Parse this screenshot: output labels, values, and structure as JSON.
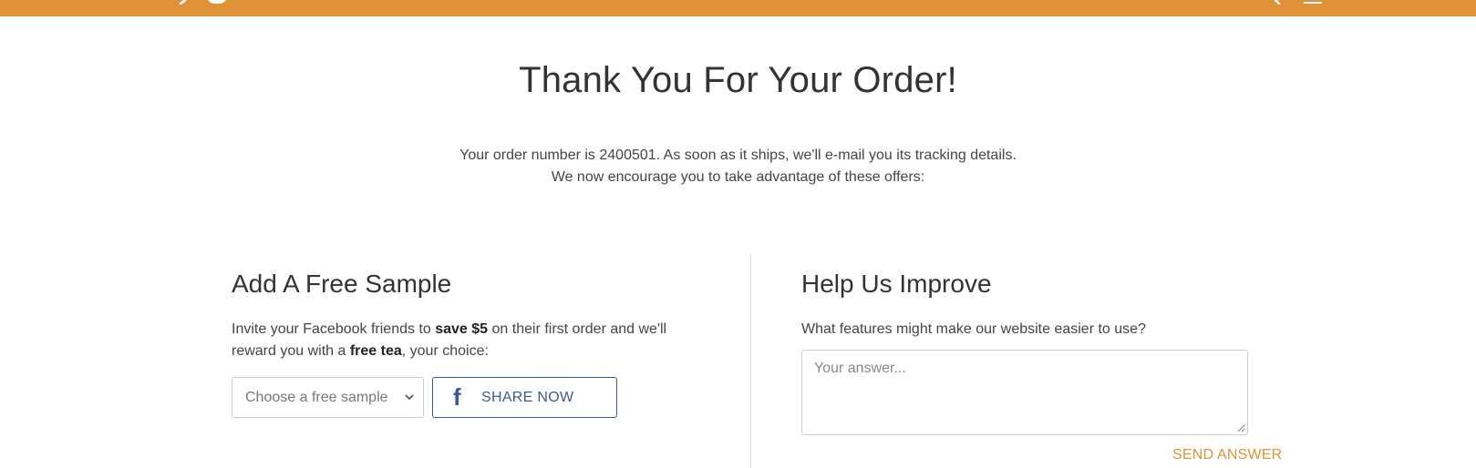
{
  "header": {
    "brand_color": "#df9236",
    "icons": [
      "leaf-logo-icon",
      "search-icon",
      "cart-icon"
    ]
  },
  "main": {
    "title": "Thank You For Your Order!",
    "intro_line1": "Your order number is 2400501. As soon as it ships, we'll e-mail you its tracking details.",
    "intro_line2": "We now encourage you to take advantage of these offers:"
  },
  "free_sample": {
    "heading": "Add A Free Sample",
    "text_part1": "Invite your Facebook friends to ",
    "text_bold1": "save $5",
    "text_part2": " on their first order and we'll",
    "text_part3": "reward you with a ",
    "text_bold2": "free tea",
    "text_part4": ", your choice:",
    "select_value": "Choose a free sample",
    "share_label": "SHARE NOW",
    "share_color": "#3b5998"
  },
  "feedback": {
    "heading": "Help Us Improve",
    "question": "What features might make our website easier to use?",
    "answer_placeholder": "Your answer...",
    "send_label": "SEND ANSWER"
  }
}
